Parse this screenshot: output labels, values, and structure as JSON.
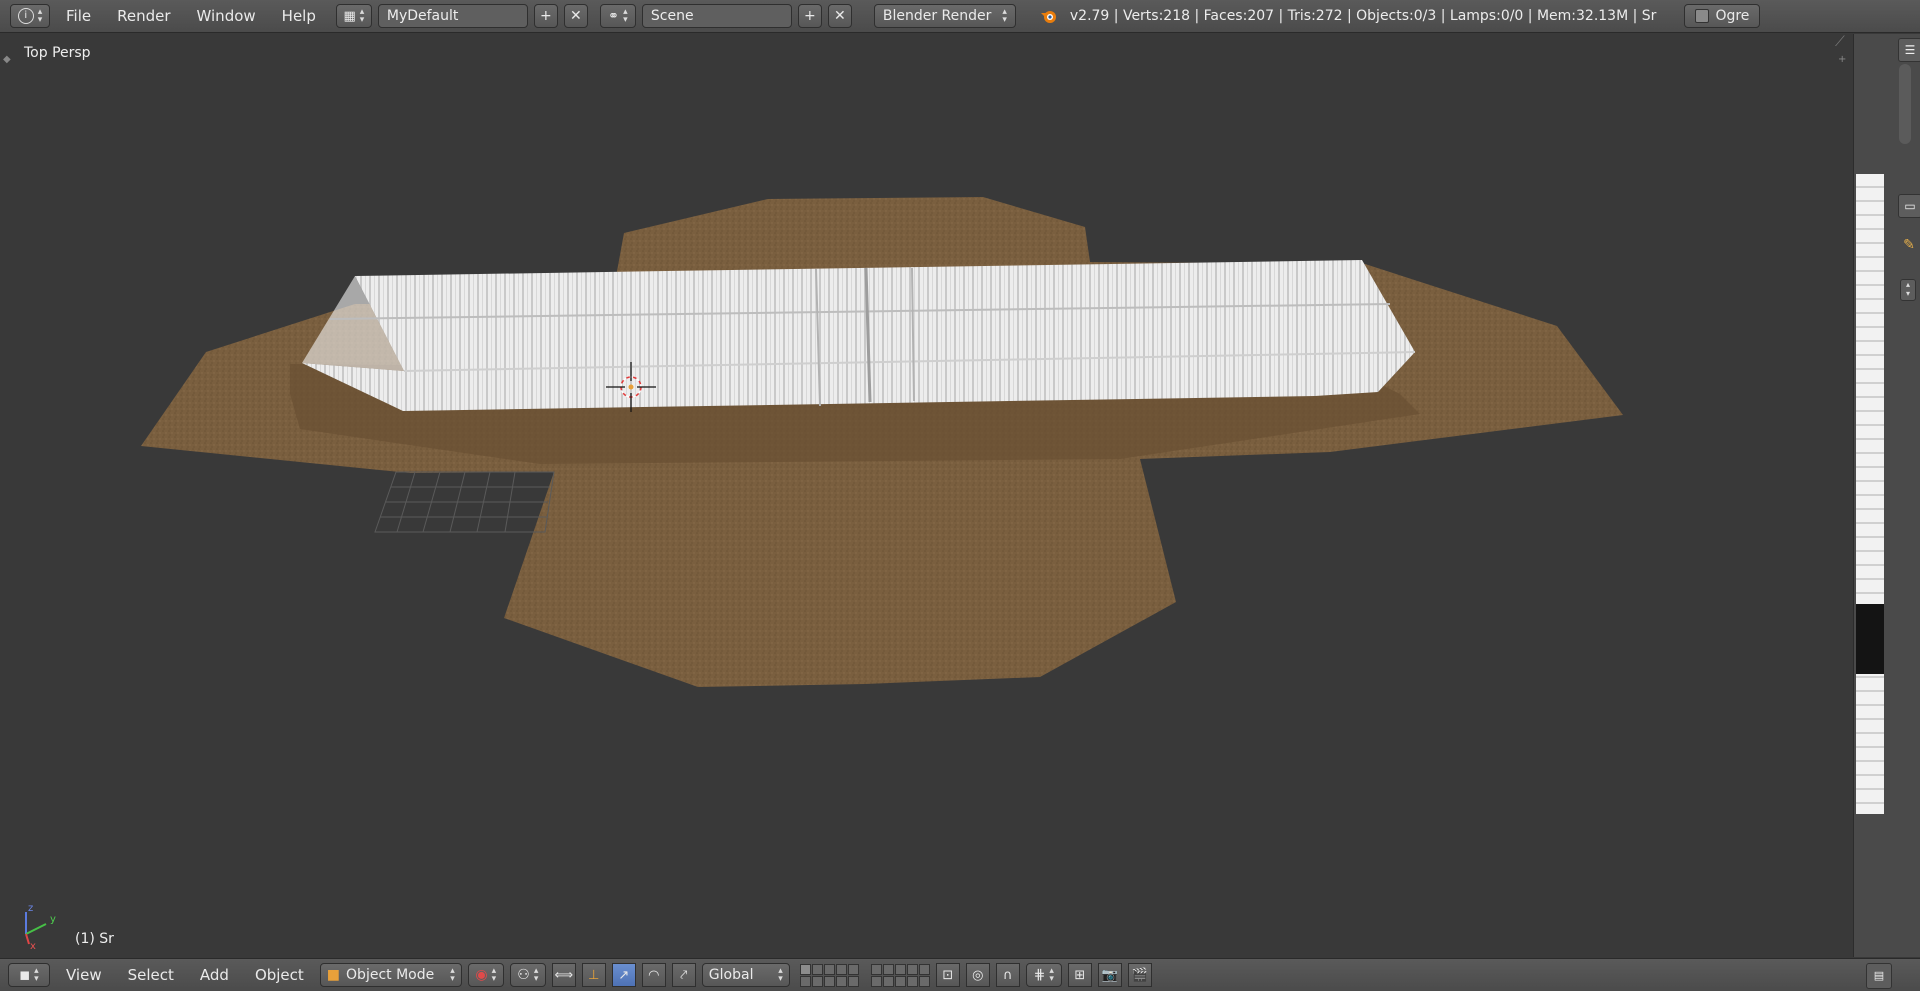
{
  "header": {
    "info_icon": "info-icon",
    "menus": [
      "File",
      "Render",
      "Window",
      "Help"
    ],
    "layout": "MyDefault",
    "scene": "Scene",
    "render_engine": "Blender Render",
    "stats": "v2.79 | Verts:218 | Faces:207 | Tris:272 | Objects:0/3 | Lamps:0/0 | Mem:32.13M | Sr",
    "ogre_label": "Ogre"
  },
  "viewport": {
    "view_label": "Top Persp",
    "active_object": "(1) Sr",
    "axis_labels": {
      "x": "x",
      "y": "y",
      "z": "z"
    }
  },
  "footer": {
    "menus": [
      "View",
      "Select",
      "Add",
      "Object"
    ],
    "mode": "Object Mode",
    "orientation": "Global"
  },
  "colors": {
    "ground": "#7a5f3f",
    "containers": "#e8e8e8",
    "background": "#393939",
    "header": "#4f4f4f"
  }
}
